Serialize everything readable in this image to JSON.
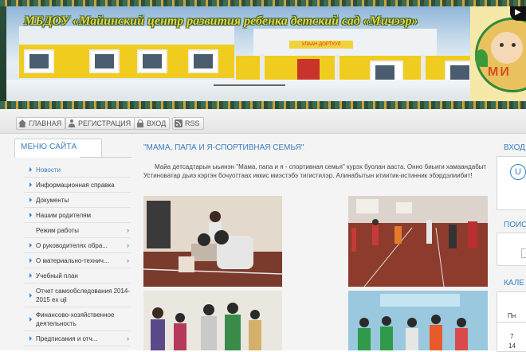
{
  "header": {
    "site_title": "МБДОУ «Майинский центр развития ребенка детский сад «Мичээр»",
    "building_sign": "УЛААН ДОРТУУЛ",
    "logo_letters": "МИ",
    "cursor_glyph": "▶"
  },
  "nav": {
    "items": [
      {
        "label": "ГЛАВНАЯ",
        "icon": "home-icon"
      },
      {
        "label": "РЕГИСТРАЦИЯ",
        "icon": "user-icon"
      },
      {
        "label": "ВХОД",
        "icon": "lock-icon"
      },
      {
        "label": "RSS",
        "icon": "rss-icon"
      }
    ]
  },
  "sidebar": {
    "title": "МЕНЮ САЙТА",
    "items": [
      {
        "label": "Новости",
        "active": true
      },
      {
        "label": "Информационная справка"
      },
      {
        "label": "Документы"
      },
      {
        "label": "Нашим родителям"
      },
      {
        "label": "Режим работы",
        "has_submenu": true
      },
      {
        "label": "О руководителях обра...",
        "has_submenu": true
      },
      {
        "label": "О материально-технич...",
        "has_submenu": true
      },
      {
        "label": "Учебный план"
      },
      {
        "label": "Отчет самообследования 2014-2015 ex ujl"
      },
      {
        "label": "Финансово-хозяйственное деятельность"
      },
      {
        "label": "Предписания и отч...",
        "has_submenu": true
      }
    ]
  },
  "article": {
    "title": "\"МАМА, ПАПА И Я-СПОРТИВНАЯ СЕМЬЯ\"",
    "body": "Майа детсадтарын ыьинэн \"Мама, папа и я - спортивная семья\" курэх буолан ааста. Онно биьиги хамаандабыт Устиноватар дьиэ кэргэн бочуоттаах иккис миэстэбэ тигистилэр. Алинабытын итиитик-истинник эбэрдэлиибит!"
  },
  "right": {
    "login_title": "ВХОД",
    "login_button": "U",
    "search_title": "ПОИС",
    "calendar_title": "КАЛЕ",
    "cal_day_header": "Пн",
    "cal_days": [
      "7",
      "14"
    ]
  },
  "colors": {
    "accent": "#3a7dc0",
    "header_title": "#f2d23c",
    "building": "#f0cc1f"
  }
}
